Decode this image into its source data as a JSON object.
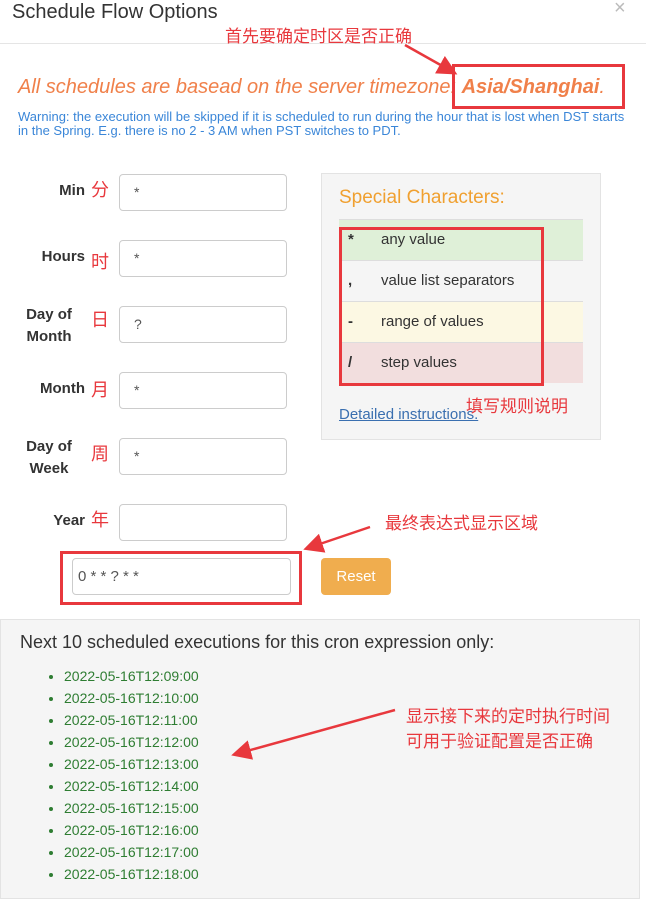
{
  "dialog": {
    "title": "Schedule Flow Options",
    "close_icon": "×"
  },
  "timezone": {
    "prefix": "All schedules are basead on the server timezone: ",
    "zone": "Asia/Shanghai",
    "suffix": "."
  },
  "warning": "Warning: the execution will be skipped if it is scheduled to run during the hour that is lost when DST starts in the Spring. E.g. there is no 2 - 3 AM when PST switches to PDT.",
  "fields": [
    {
      "label": "Min",
      "cn": "分",
      "value": "*"
    },
    {
      "label": "Hours",
      "cn": "时",
      "value": "*"
    },
    {
      "label": "Day of Month",
      "cn": "日",
      "value": "?"
    },
    {
      "label": "Month",
      "cn": "月",
      "value": "*"
    },
    {
      "label": "Day of Week",
      "cn": "周",
      "value": "*"
    },
    {
      "label": "Year",
      "cn": "年",
      "value": ""
    }
  ],
  "special": {
    "title": "Special Characters:",
    "rows": [
      {
        "char": "*",
        "desc": "any value",
        "color": "#dff0d8"
      },
      {
        "char": ",",
        "desc": "value list separators",
        "color": "#f5f5f5"
      },
      {
        "char": "-",
        "desc": "range of values",
        "color": "#fcf8e3"
      },
      {
        "char": "/",
        "desc": "step values",
        "color": "#f2dede"
      }
    ],
    "link": "Detailed instructions."
  },
  "expression": "0  * * ? * *",
  "reset_label": "Reset",
  "next": {
    "title": "Next 10 scheduled executions for this cron expression only:",
    "items": [
      "2022-05-16T12:09:00",
      "2022-05-16T12:10:00",
      "2022-05-16T12:11:00",
      "2022-05-16T12:12:00",
      "2022-05-16T12:13:00",
      "2022-05-16T12:14:00",
      "2022-05-16T12:15:00",
      "2022-05-16T12:16:00",
      "2022-05-16T12:17:00",
      "2022-05-16T12:18:00"
    ]
  },
  "annotations": {
    "timezone": "首先要确定时区是否正确",
    "rules": "填写规则说明",
    "expression": "最终表达式显示区域",
    "next1": "显示接下来的定时执行时间",
    "next2": "可用于验证配置是否正确"
  }
}
